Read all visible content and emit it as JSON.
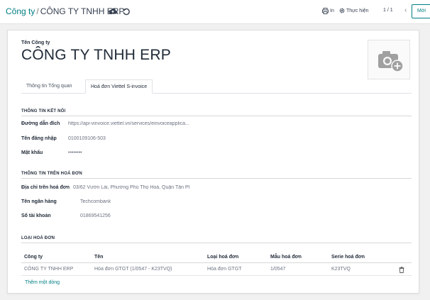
{
  "breadcrumb": {
    "parent": "Công ty",
    "separator": "/",
    "current": "CÔNG TY TNHH ERP"
  },
  "toolbar": {
    "print_label": "In",
    "action_label": "Thực hiện",
    "pager": "1 / 1",
    "new_label": "Mới"
  },
  "company": {
    "name_label": "Tên Công ty",
    "name_value": "CÔNG TY TNHH ERP"
  },
  "tabs": [
    {
      "label": "Thông tin Tổng quan",
      "active": false
    },
    {
      "label": "Hoá đơn Viettel S-invoice",
      "active": true
    }
  ],
  "connection": {
    "title": "THÔNG TIN KẾT NỐI",
    "fields": [
      {
        "label": "Đường dẫn đích",
        "value": "https://api-vinvoice.viettel.vn/services/einvoiceapplica..."
      },
      {
        "label": "Tên đăng nhập",
        "value": "0100109106-503"
      },
      {
        "label": "Mật khẩu",
        "value": "••••••••"
      }
    ]
  },
  "invoice_info": {
    "title": "THÔNG TIN TRÊN HOÁ ĐƠN",
    "fields": [
      {
        "label": "Địa chỉ trên hoá đơn",
        "value": "03/62 Vườn Lài, Phường Phú Thọ Hoà, Quận Tân Pl"
      },
      {
        "label": "Tên ngân hàng",
        "value": "Techcombank"
      },
      {
        "label": "Số tài khoản",
        "value": "01869541256"
      }
    ]
  },
  "invoice_types": {
    "title": "LOẠI HOÁ ĐƠN",
    "columns": [
      "Công ty",
      "Tên",
      "Loại hoá đơn",
      "Mẫu hoá đơn",
      "Serie hoá đơn"
    ],
    "rows": [
      [
        "CÔNG TY TNHH ERP",
        "Hóa đơn GTGT (1/0547 - K23TVQ)",
        "Hóa đơn GTGT",
        "1/0547",
        "K23TVQ"
      ]
    ],
    "add_line_label": "Thêm một dòng"
  }
}
